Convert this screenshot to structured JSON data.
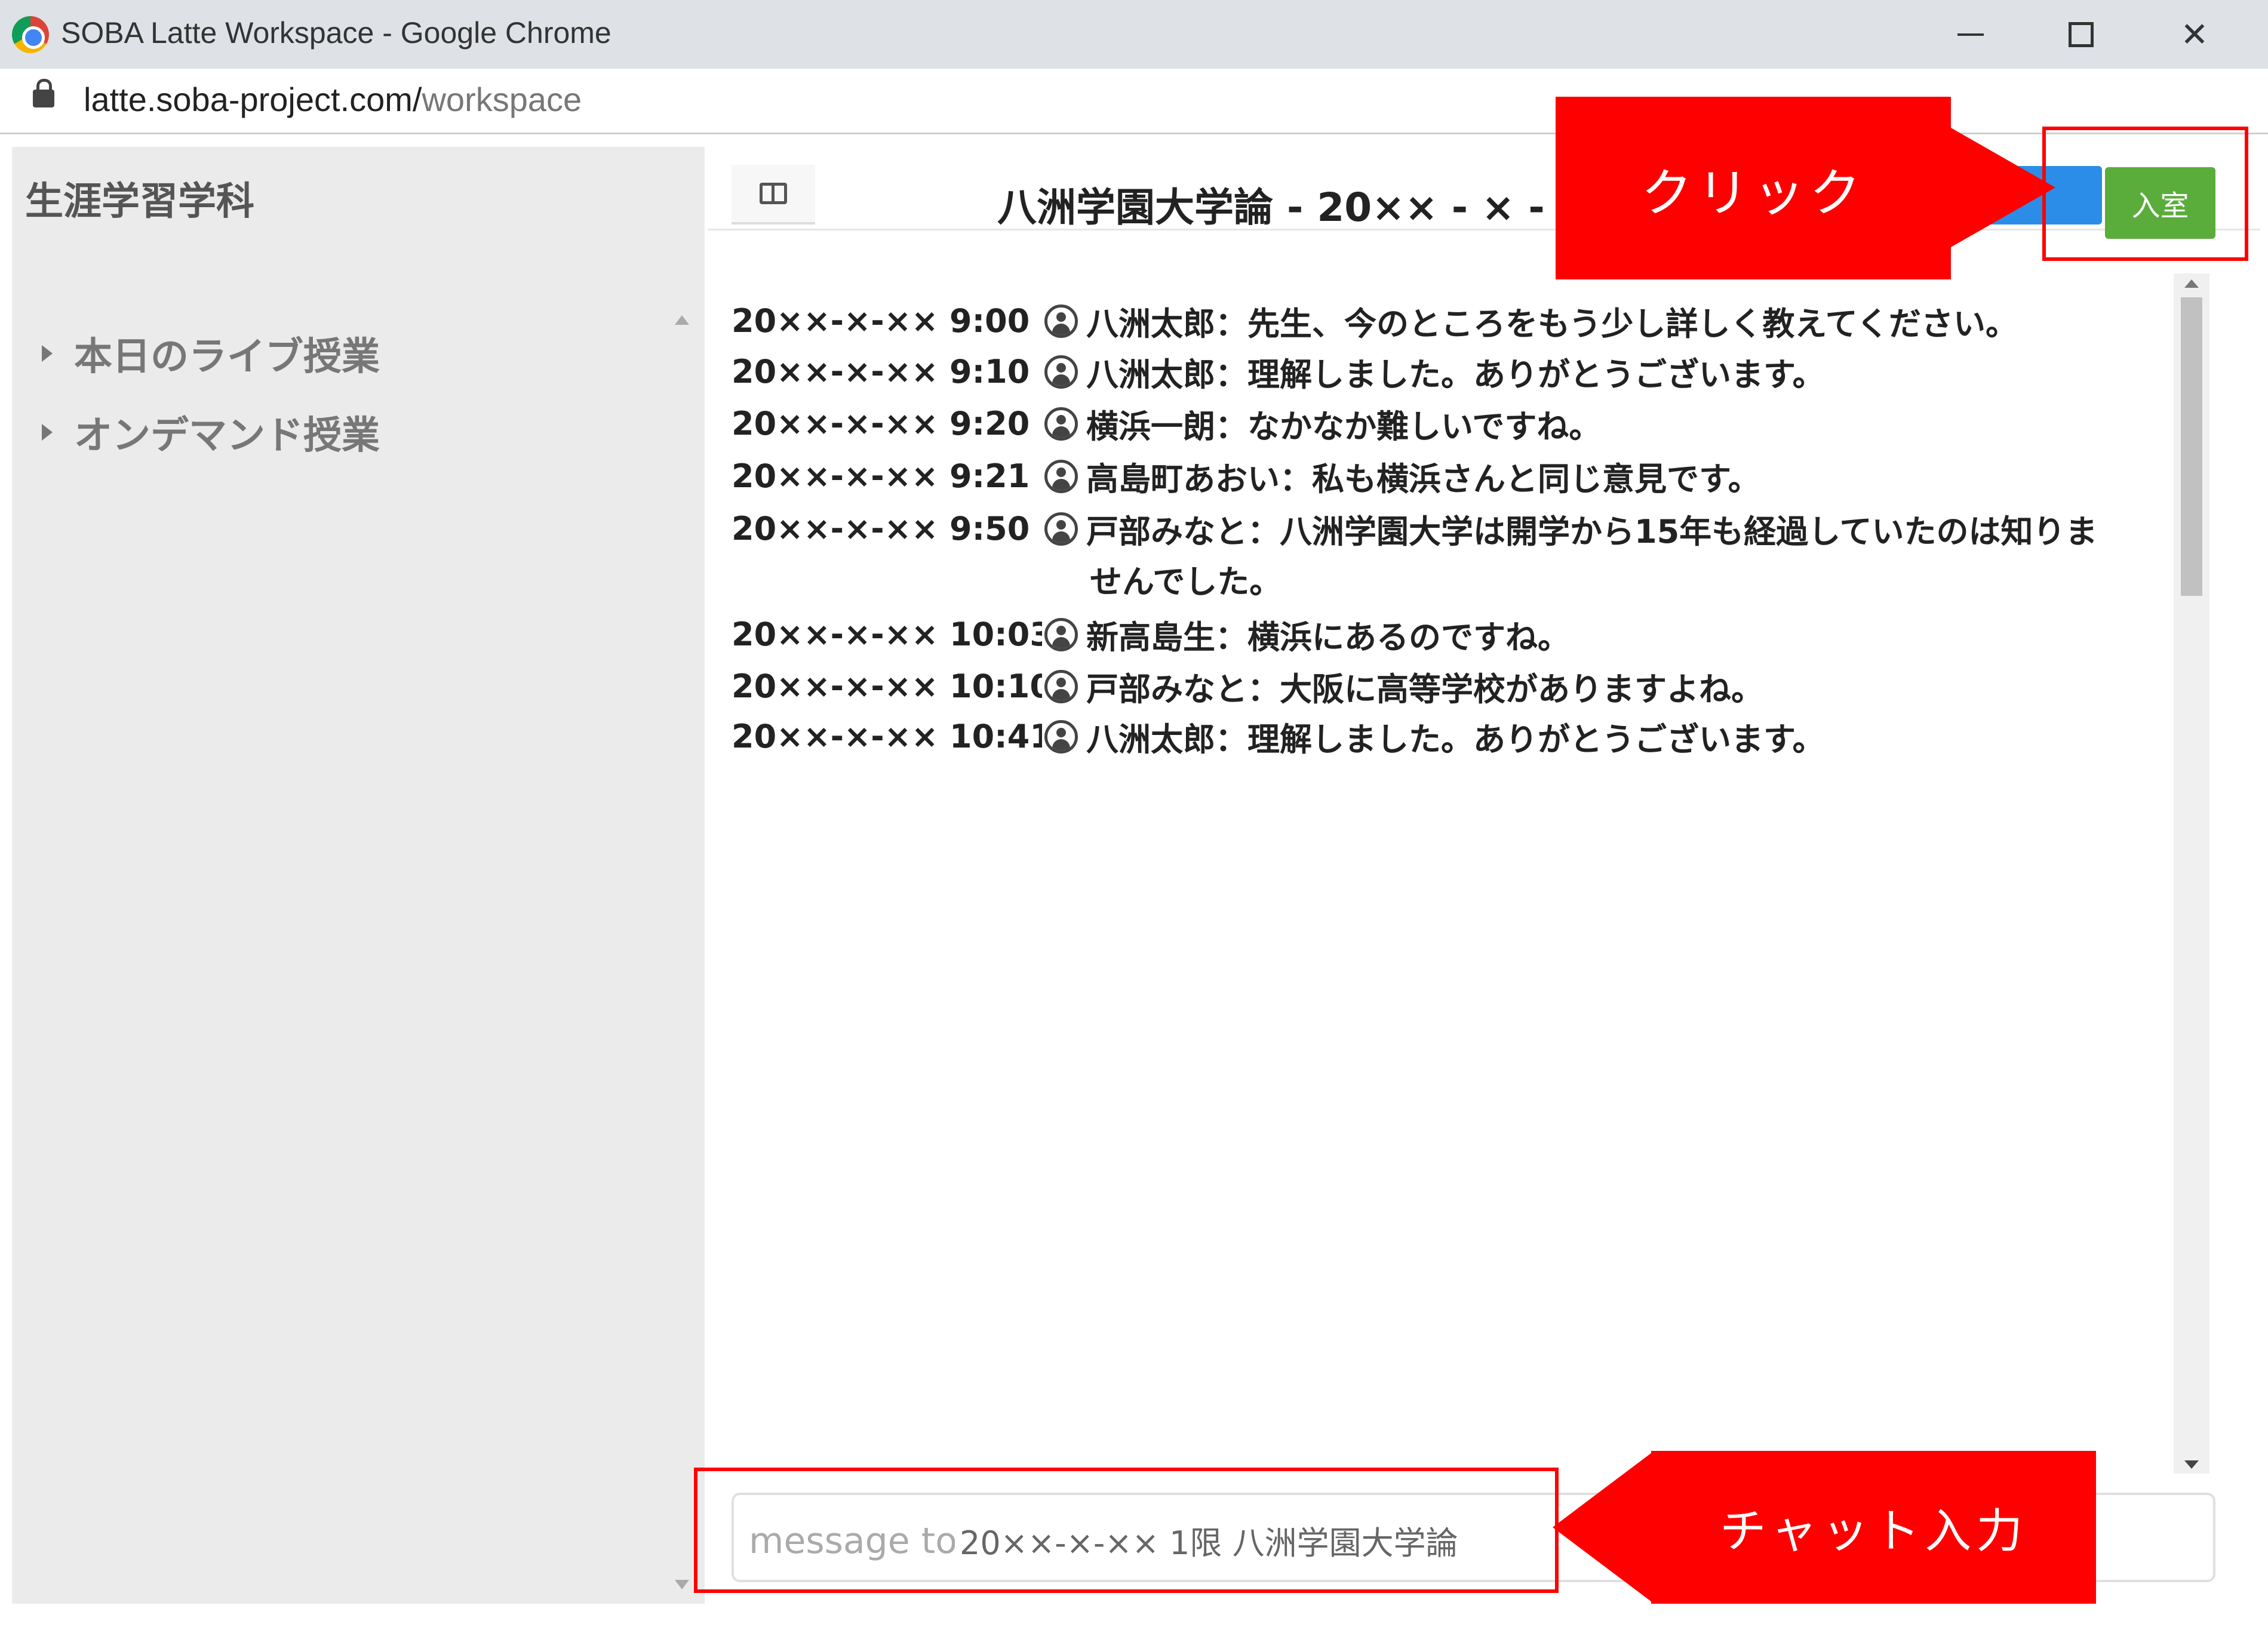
{
  "window": {
    "title": "SOBA Latte Workspace - Google Chrome",
    "url_host": "latte.soba-project.com/",
    "url_path": "workspace"
  },
  "sidebar": {
    "course_name": "生涯学習学科",
    "items": [
      {
        "label": "本日のライブ授業"
      },
      {
        "label": "オンデマンド授業"
      }
    ]
  },
  "header": {
    "title": "八洲学園大学論 - 20×× - × -",
    "enter_label": "入室"
  },
  "chat": {
    "messages": [
      {
        "timestamp": "20××-×-×× 9:00",
        "text": "八洲太郎：先生、今のところをもう少し詳しく教えてください。"
      },
      {
        "timestamp": "20××-×-×× 9:10",
        "text": "八洲太郎：理解しました。ありがとうございます。"
      },
      {
        "timestamp": "20××-×-×× 9:20",
        "text": "横浜一朗：なかなか難しいですね。"
      },
      {
        "timestamp": "20××-×-×× 9:21",
        "text": "高島町あおい：私も横浜さんと同じ意見です。"
      },
      {
        "timestamp": "20××-×-×× 9:50",
        "text": "戸部みなと：八洲学園大学は開学から15年も経過していたのは知りま",
        "continuation": "せんでした。"
      },
      {
        "timestamp": "20××-×-×× 10:03",
        "text": " 新高島生：横浜にあるのですね。"
      },
      {
        "timestamp": "20××-×-×× 10:10",
        "text": " 戸部みなと：大阪に高等学校がありますよね。"
      },
      {
        "timestamp": "20××-×-×× 10:41",
        "text": " 八洲太郎：理解しました。ありがとうございます。"
      }
    ]
  },
  "input": {
    "placeholder": "message to :",
    "channel": "20××-×-×× 1限 八洲学園大学論"
  },
  "annotations": {
    "click_label": "クリック",
    "chat_input_label": "チャット入力",
    "highlight_color": "#ff0000"
  },
  "colors": {
    "enter_button": "#5aac3b",
    "blue_button": "#2b8de8"
  }
}
